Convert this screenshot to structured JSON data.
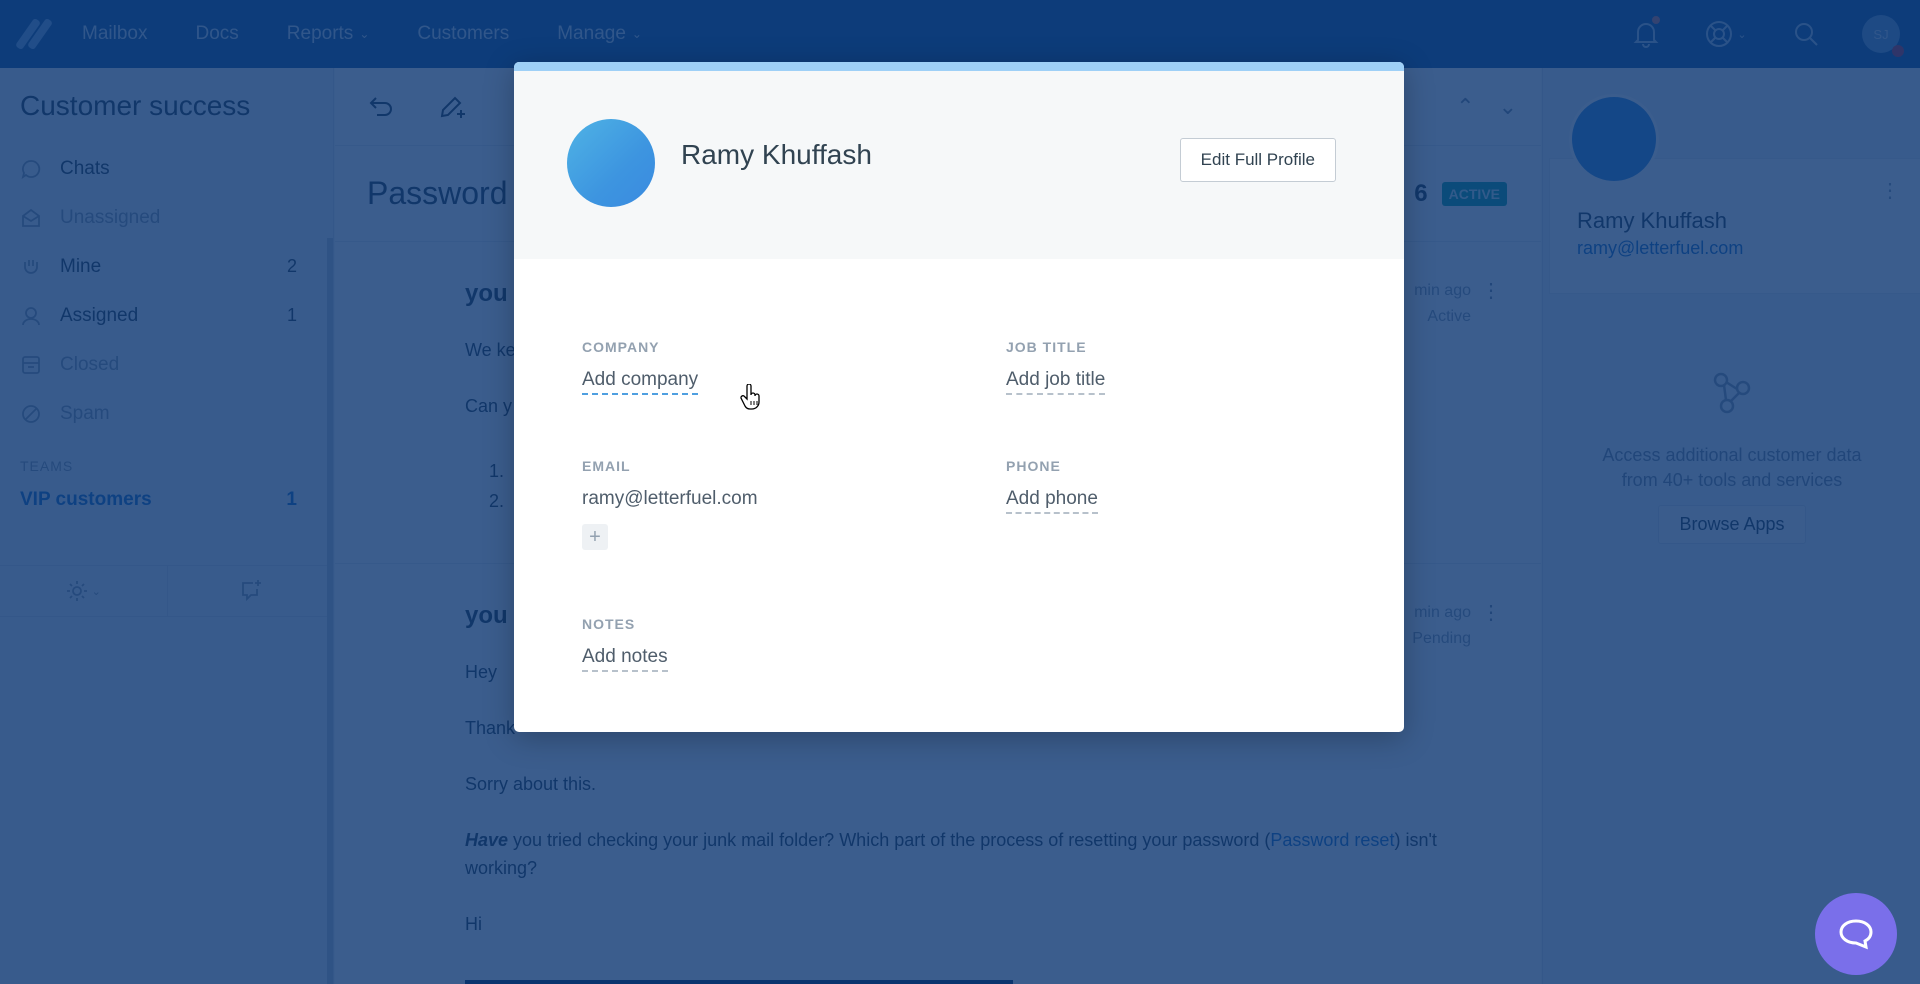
{
  "topnav": {
    "items": [
      {
        "label": "Mailbox",
        "dropdown": false
      },
      {
        "label": "Docs",
        "dropdown": false
      },
      {
        "label": "Reports",
        "dropdown": true
      },
      {
        "label": "Customers",
        "dropdown": false
      },
      {
        "label": "Manage",
        "dropdown": true
      }
    ],
    "icons": [
      "bell-icon",
      "help-lifebuoy-icon",
      "search-icon"
    ],
    "user_initials": "SJ"
  },
  "sidebar": {
    "title": "Customer success",
    "items": [
      {
        "label": "Chats",
        "icon": "chat-icon",
        "count": "",
        "dim": false
      },
      {
        "label": "Unassigned",
        "icon": "envelope-open-icon",
        "count": "",
        "dim": true
      },
      {
        "label": "Mine",
        "icon": "hand-icon",
        "count": "2",
        "dim": false
      },
      {
        "label": "Assigned",
        "icon": "person-icon",
        "count": "1",
        "dim": false
      },
      {
        "label": "Closed",
        "icon": "archive-icon",
        "count": "",
        "dim": true
      },
      {
        "label": "Spam",
        "icon": "block-icon",
        "count": "",
        "dim": true
      }
    ],
    "teams_heading": "TEAMS",
    "teams": [
      {
        "label": "VIP customers",
        "count": "1"
      }
    ]
  },
  "conversation": {
    "title": "Password",
    "number_fragment": "6",
    "status_badge": "ACTIVE",
    "threads": [
      {
        "author": "you",
        "lines": [
          "We ke",
          "Can y"
        ],
        "list": [
          "1.",
          "2."
        ],
        "time": "min ago",
        "status": "Active"
      },
      {
        "author": "you",
        "lines": [
          "Hey",
          "Thank",
          "Sorry about this."
        ],
        "rich_strong": "Have",
        "rich_text_before_link": " you tried checking your junk mail folder? Which part of the process of resetting your password (",
        "rich_link": "Password reset",
        "rich_text_after_link": ") isn't working?",
        "closing": "Hi",
        "time": "min ago",
        "status": "Pending"
      }
    ]
  },
  "profile_panel": {
    "name": "Ramy Khuffash",
    "email": "ramy@letterfuel.com",
    "apps_text_1": "Access additional customer data",
    "apps_text_2": "from 40+ tools and services",
    "browse_button": "Browse Apps"
  },
  "modal": {
    "name": "Ramy Khuffash",
    "edit_button": "Edit Full Profile",
    "fields": {
      "company": {
        "label": "COMPANY",
        "value": "Add company"
      },
      "job_title": {
        "label": "JOB TITLE",
        "value": "Add job title"
      },
      "email": {
        "label": "EMAIL",
        "value": "ramy@letterfuel.com",
        "add_label": "+"
      },
      "phone": {
        "label": "PHONE",
        "value": "Add phone"
      },
      "notes": {
        "label": "NOTES",
        "value": "Add notes"
      }
    }
  },
  "colors": {
    "nav_bg": "#1b5d9f",
    "overlay": "#0a3470",
    "modal_stripe": "#9ed0f7",
    "active_badge": "#0fa3a0",
    "link": "#1f73c8",
    "beacon": "#7a6fea"
  }
}
